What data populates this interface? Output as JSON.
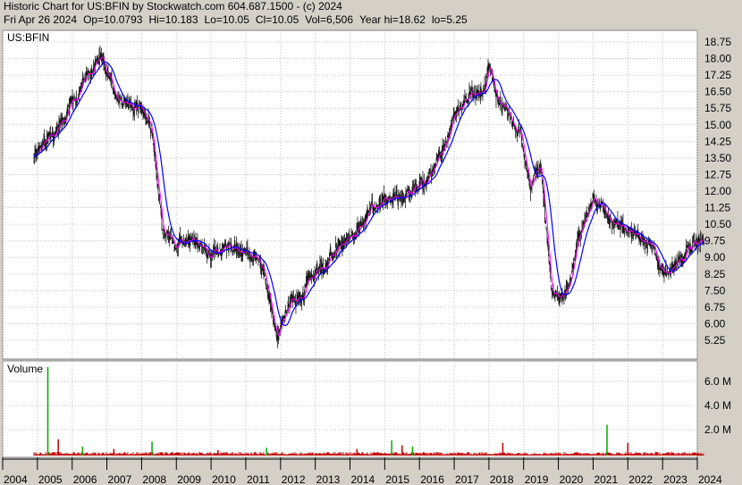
{
  "header": {
    "line1": "Historic Chart for US:BFIN by Stockwatch.com 604.687.1500 - (c) 2024",
    "date": "Fri Apr 26 2024",
    "open": "Op=10.0793",
    "high": "Hi=10.183",
    "low": "Lo=10.05",
    "close": "Cl=10.05",
    "volume": "Vol=6,506",
    "year_high": "Year hi=18.62",
    "year_low": "lo=5.25"
  },
  "price_panel": {
    "symbol_label": "US:BFIN"
  },
  "volume_panel": {
    "label": "Volume"
  },
  "colors": {
    "background": "#d4d0c8",
    "panel": "#ffffff",
    "grid": "#c0c0c0",
    "price_bars": "#000000",
    "ma_short": "#ff00ff",
    "ma_long": "#0000ff",
    "volume_bars": "#c00000",
    "volume_spikes": "#00aa00"
  },
  "chart_data": [
    {
      "type": "line",
      "title": "",
      "series": [],
      "x": [
        2004.9,
        2005.3,
        2005.8,
        2006.3,
        2006.8,
        2007.2,
        2007.6,
        2008.0,
        2008.3,
        2008.6,
        2009.0,
        2009.5,
        2010.0,
        2010.5,
        2011.0,
        2011.5,
        2011.9,
        2012.3,
        2012.8,
        2013.3,
        2013.8,
        2014.2,
        2014.6,
        2015.0,
        2015.4,
        2015.8,
        2016.2,
        2016.6,
        2017.0,
        2017.4,
        2017.8,
        2018.0,
        2018.3,
        2018.6,
        2018.9,
        2019.2,
        2019.5,
        2019.8,
        2020.1,
        2020.3,
        2020.6,
        2021.0,
        2021.3,
        2021.6,
        2022.0,
        2022.4,
        2022.7,
        2023.0,
        2023.4,
        2023.8,
        2024.2
      ],
      "y": [
        13.5,
        14.5,
        15.3,
        16.8,
        18.0,
        16.5,
        16.0,
        15.8,
        14.8,
        10.2,
        9.5,
        9.6,
        9.2,
        9.4,
        9.4,
        8.5,
        5.6,
        6.8,
        7.8,
        8.6,
        9.6,
        10.3,
        11.2,
        11.8,
        11.9,
        12.0,
        12.4,
        13.5,
        15.5,
        16.5,
        16.3,
        17.8,
        16.0,
        15.0,
        14.8,
        12.2,
        13.2,
        7.5,
        7.3,
        7.8,
        9.9,
        11.5,
        11.2,
        10.6,
        10.2,
        9.8,
        10.0,
        8.2,
        8.6,
        9.2,
        10.1
      ],
      "ylim": [
        5.0,
        19.0
      ],
      "y_ticks": [
        "18.75",
        "18.00",
        "17.25",
        "16.50",
        "15.75",
        "15.00",
        "14.25",
        "13.50",
        "12.75",
        "12.00",
        "11.25",
        "10.50",
        "9.75",
        "9.00",
        "8.25",
        "7.50",
        "6.75",
        "6.00",
        "5.25"
      ],
      "x_ticks": [
        "2004",
        "2005",
        "2006",
        "2007",
        "2008",
        "2009",
        "2010",
        "2011",
        "2012",
        "2013",
        "2014",
        "2015",
        "2016",
        "2017",
        "2018",
        "2019",
        "2020",
        "2021",
        "2022",
        "2023",
        "2024"
      ],
      "grid": true
    },
    {
      "type": "bar",
      "title": "",
      "series": [],
      "x": [
        2005.3,
        2005.6,
        2006.3,
        2007.2,
        2008.3,
        2010.2,
        2011.6,
        2014.2,
        2015.2,
        2015.5,
        2015.8,
        2018.4,
        2021.4,
        2022.0
      ],
      "values": [
        7.2,
        1.2,
        0.6,
        0.4,
        1.0,
        0.3,
        0.5,
        0.4,
        1.1,
        0.7,
        0.6,
        0.9,
        2.4,
        0.9
      ],
      "ylim": [
        0,
        7.5
      ],
      "y_ticks": [
        "6.0 M",
        "4.0 M",
        "2.0 M"
      ],
      "grid": true
    }
  ]
}
